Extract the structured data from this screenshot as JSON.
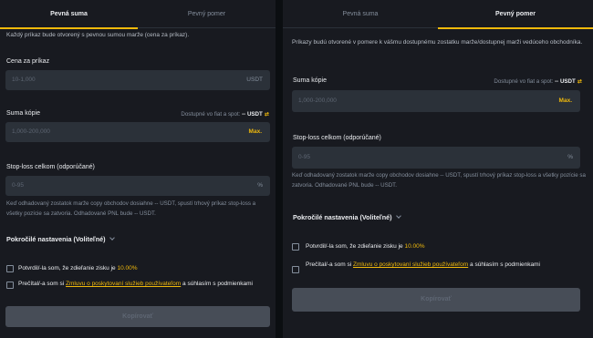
{
  "left": {
    "tabs": [
      "Pevná suma",
      "Pevný pomer"
    ],
    "description": "Každý príkaz bude otvorený s pevnou sumou marže (cena za príkaz).",
    "price_label": "Cena za príkaz",
    "price_placeholder": "10-1,000",
    "price_unit": "USDT",
    "amount_label": "Suma kópie",
    "available_label": "Dostupné vo fiat a spot:",
    "available_value": "-- USDT",
    "amount_placeholder": "1,000-200,000",
    "max_label": "Max.",
    "stoploss_label": "Stop-loss celkom (odporúčané)",
    "stoploss_placeholder": "0-95",
    "stoploss_unit": "%",
    "stoploss_note": "Keď odhadovaný zostatok marže copy obchodov dosiahne -- USDT, spustí trhový príkaz stop-loss a všetky pozície sa zatvoria. Odhadované PNL bude -- USDT.",
    "advanced_label": "Pokročilé nastavenia (Voliteľné)",
    "confirm1_text": "Potvrdil/-la som, že zdieľanie zisku je",
    "confirm1_pct": "10.00%",
    "confirm2_prefix": "Prečítal/-a som si",
    "confirm2_link": "Zmluvu o poskytovaní služieb používateľom",
    "confirm2_suffix": "a súhlasím s podmienkami",
    "button_label": "Kopírovať"
  },
  "right": {
    "tabs": [
      "Pevná suma",
      "Pevný pomer"
    ],
    "description": "Príkazy budú otvorené v pomere k vášmu dostupnému zostatku marže/dostupnej marži vedúceho obchodníka.",
    "amount_label": "Suma kópie",
    "available_label": "Dostupné vo fiat a spot:",
    "available_value": "-- USDT",
    "amount_placeholder": "1,000-200,000",
    "max_label": "Max.",
    "stoploss_label": "Stop-loss celkom (odporúčané)",
    "stoploss_placeholder": "0-95",
    "stoploss_unit": "%",
    "stoploss_note": "Keď odhadovaný zostatok marže copy obchodov dosiahne -- USDT, spustí trhový príkaz stop-loss a všetky pozície sa zatvoria. Odhadované PNL bude -- USDT.",
    "advanced_label": "Pokročilé nastavenia (Voliteľné)",
    "confirm1_text": "Potvrdil/-la som, že zdieľanie zisku je",
    "confirm1_pct": "10.00%",
    "confirm2_prefix": "Prečítal/-a som si",
    "confirm2_link": "Zmluvu o poskytovaní služieb používateľom",
    "confirm2_suffix": "a súhlasím s podmienkami",
    "button_label": "Kopírovať"
  },
  "colors": {
    "accent": "#f0b90b",
    "panel": "#181a20",
    "input": "#2b3139"
  },
  "icons": {
    "swap": "swap-icon",
    "chevron": "chevron-down-icon"
  }
}
